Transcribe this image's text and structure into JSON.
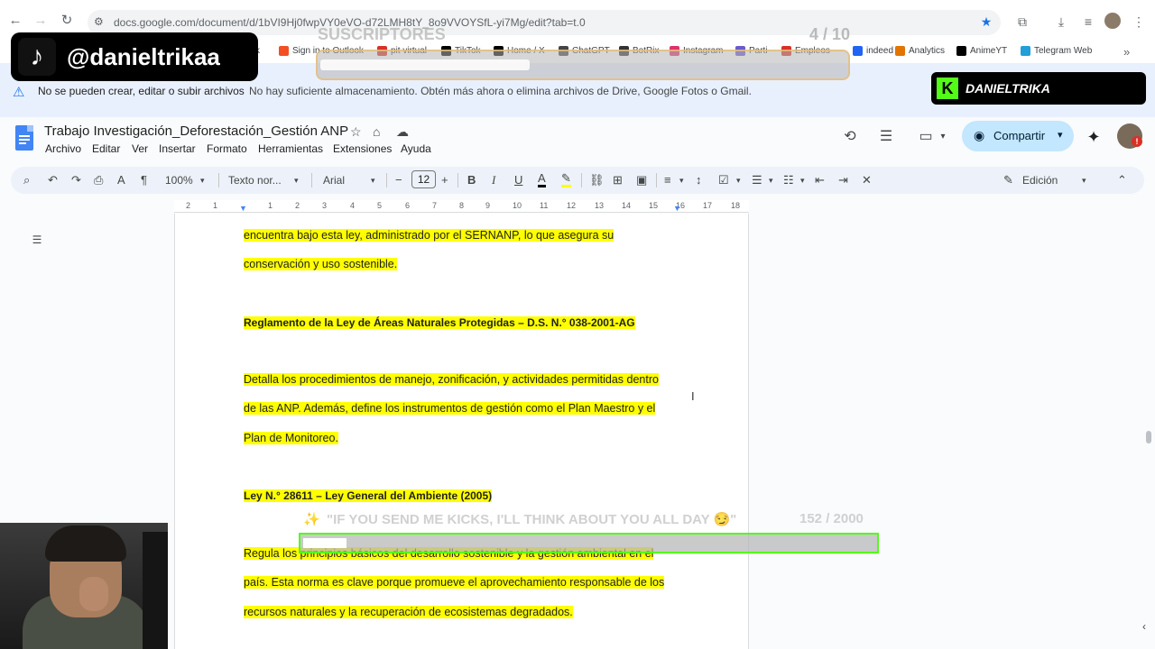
{
  "browser": {
    "url": "docs.google.com/document/d/1bVI9Hj0fwpVY0eVO-d72LMH8tY_8o9VVOYSfL-yi7Mg/edit?tab=t.0",
    "bookmarks": [
      {
        "label": "k",
        "color": "#888888"
      },
      {
        "label": "Sign in to Outlook",
        "color": "#f25022"
      },
      {
        "label": "pit virtual",
        "color": "#d93025"
      },
      {
        "label": "TikTok",
        "color": "#000000"
      },
      {
        "label": "Home / X",
        "color": "#000000"
      },
      {
        "label": "ChatGPT",
        "color": "#444444"
      },
      {
        "label": "BotRix",
        "color": "#333333"
      },
      {
        "label": "Instagram",
        "color": "#e1306c"
      },
      {
        "label": "Parti",
        "color": "#6a5acd"
      },
      {
        "label": "Empleos",
        "color": "#d93025"
      },
      {
        "label": "indeed",
        "color": "#2164f3"
      },
      {
        "label": "Analytics",
        "color": "#e37400"
      },
      {
        "label": "AnimeYT",
        "color": "#000000"
      },
      {
        "label": "Telegram Web",
        "color": "#229ed9"
      }
    ],
    "more_bookmarks": "»"
  },
  "banner": {
    "title": "No se pueden crear, editar o subir archivos",
    "message": "No hay suficiente almacenamiento. Obtén más ahora o elimina archivos de Drive, Google Fotos o Gmail."
  },
  "doc": {
    "title": "Trabajo Investigación_Deforestación_Gestión ANP",
    "menus": [
      "Archivo",
      "Editar",
      "Ver",
      "Insertar",
      "Formato",
      "Herramientas",
      "Extensiones",
      "Ayuda"
    ],
    "share_label": "Compartir",
    "avatar_badge": "!"
  },
  "toolbar": {
    "zoom": "100%",
    "style": "Texto nor...",
    "font": "Arial",
    "font_size": "12",
    "mode": "Edición"
  },
  "ruler": {
    "numbers": [
      "2",
      "1",
      "1",
      "2",
      "3",
      "4",
      "5",
      "6",
      "7",
      "8",
      "9",
      "10",
      "11",
      "12",
      "13",
      "14",
      "15",
      "16",
      "17",
      "18"
    ]
  },
  "content": {
    "p1_line1": "encuentra bajo esta ley, administrado por el SERNANP, lo que asegura su",
    "p1_line2": "conservación y uso sostenible.",
    "h1": "Reglamento de la Ley de Áreas Naturales Protegidas – D.S. N.° 038-2001-AG",
    "p2_line1": "Detalla los procedimientos de manejo, zonificación, y actividades permitidas dentro",
    "p2_line2": "de las ANP. Además, define los instrumentos de gestión como el Plan Maestro y el",
    "p2_line3": "Plan de Monitoreo.",
    "h2": "Ley N.° 28611 – Ley General del Ambiente (2005)",
    "p3_line1": "Regula los principios básicos del desarrollo sostenible y la gestión ambiental en el",
    "p3_line2": "país. Esta norma es clave porque promueve el aprovechamiento responsable de los",
    "p3_line3": "recursos naturales y la recuperación de ecosistemas degradados."
  },
  "overlays": {
    "tiktok_handle": "@danieltrikaa",
    "subs_label": "SUSCRIPTORES",
    "subs_count": "4  / 10",
    "subs_progress": 0.4,
    "kick_name": "DANIELTRIKA",
    "kick_logo": "K",
    "goal_text": "\"IF YOU SEND ME KICKS, I'LL THINK ABOUT YOU ALL DAY 😏\"",
    "goal_count": "152  / 2000",
    "goal_progress": 0.076
  },
  "colors": {
    "highlight": "#ffff00",
    "share_bg": "#c2e7ff",
    "kick_green": "#53fc18",
    "banner_bg": "#e8f0fe"
  }
}
